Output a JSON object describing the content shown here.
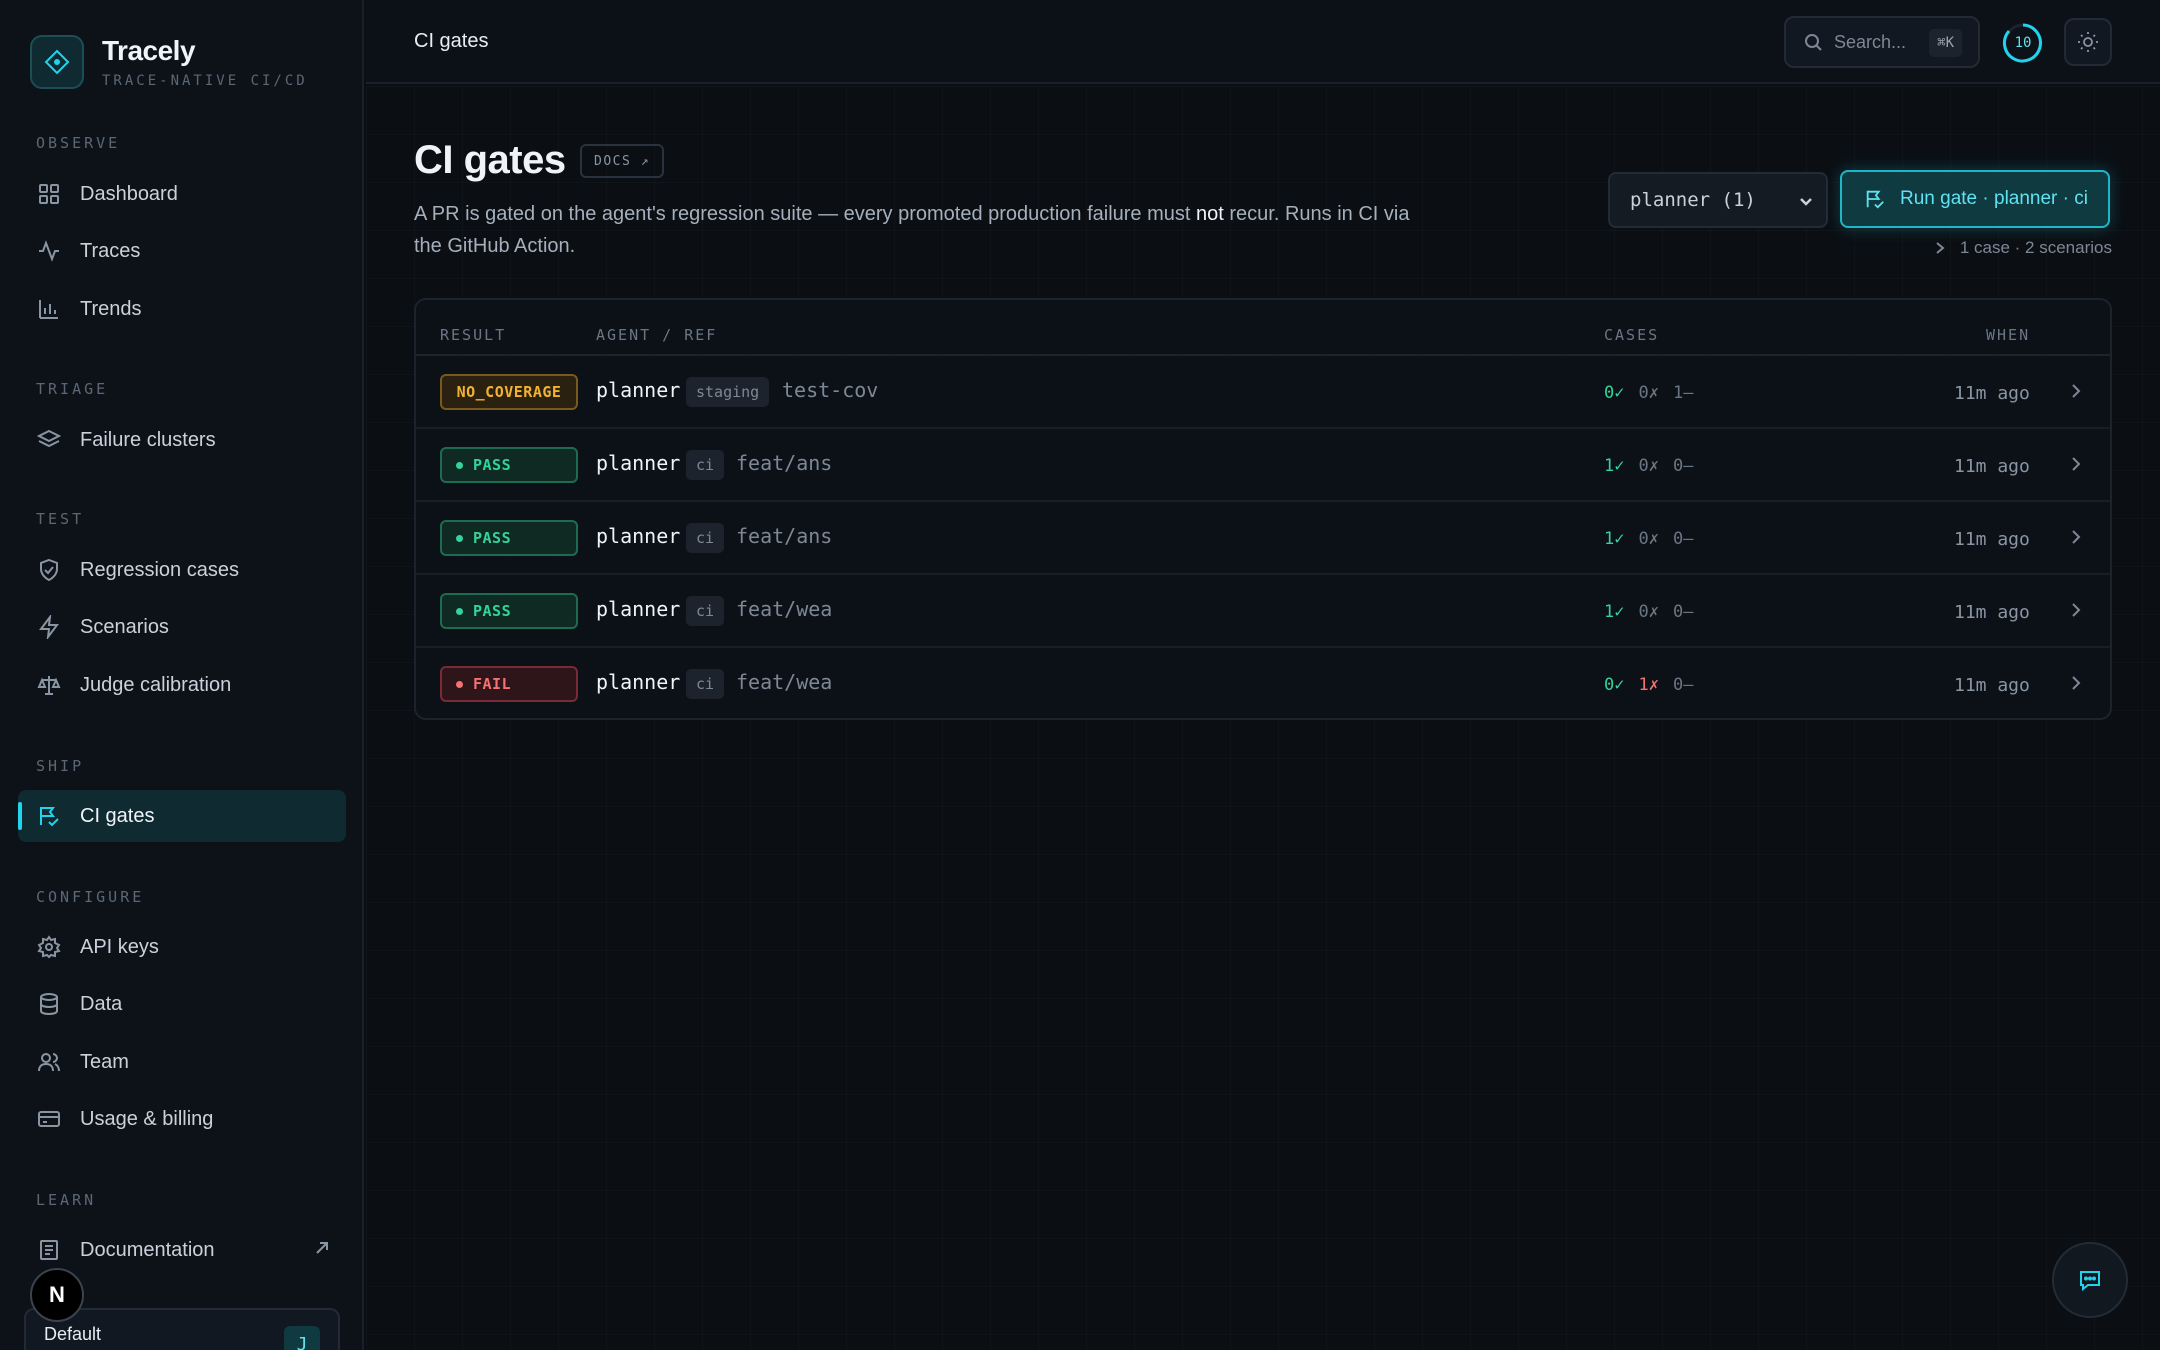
{
  "brand": {
    "name": "Tracely",
    "tagline": "TRACE-NATIVE CI/CD"
  },
  "sidebar": {
    "sections": [
      {
        "label": "OBSERVE",
        "items": [
          {
            "label": "Dashboard",
            "icon": "grid-icon"
          },
          {
            "label": "Traces",
            "icon": "activity-icon"
          },
          {
            "label": "Trends",
            "icon": "bar-chart-icon"
          }
        ]
      },
      {
        "label": "TRIAGE",
        "items": [
          {
            "label": "Failure clusters",
            "icon": "layers-icon"
          }
        ]
      },
      {
        "label": "TEST",
        "items": [
          {
            "label": "Regression cases",
            "icon": "shield-check-icon"
          },
          {
            "label": "Scenarios",
            "icon": "zap-icon"
          },
          {
            "label": "Judge calibration",
            "icon": "scale-icon"
          }
        ]
      },
      {
        "label": "SHIP",
        "items": [
          {
            "label": "CI gates",
            "icon": "flag-check-icon",
            "active": true
          }
        ]
      },
      {
        "label": "CONFIGURE",
        "items": [
          {
            "label": "API keys",
            "icon": "gear-icon"
          },
          {
            "label": "Data",
            "icon": "database-icon"
          },
          {
            "label": "Team",
            "icon": "users-icon"
          },
          {
            "label": "Usage & billing",
            "icon": "credit-card-icon"
          }
        ]
      },
      {
        "label": "LEARN",
        "items": [
          {
            "label": "Documentation",
            "icon": "book-icon",
            "external": true
          }
        ]
      }
    ],
    "workspace": {
      "name": "Default",
      "avatar": "J"
    },
    "n_badge": "N"
  },
  "topbar": {
    "breadcrumb": "CI gates",
    "search": {
      "placeholder": "Search...",
      "shortcut": "⌘K"
    },
    "counter": "10"
  },
  "page": {
    "title": "CI gates",
    "docs_label": "DOCS ↗",
    "description_before": "A PR is gated on the agent's regression suite — every promoted production failure must ",
    "description_emph": "not",
    "description_after": " recur. Runs in CI via the GitHub Action.",
    "agent_select": "planner (1)",
    "run_button": "Run gate · planner · ci",
    "case_summary": "1 case · 2 scenarios"
  },
  "table": {
    "columns": {
      "result": "RESULT",
      "agent_ref": "AGENT / REF",
      "cases": "CASES",
      "when": "WHEN"
    },
    "rows": [
      {
        "result": "NO_COVERAGE",
        "agent": "planner",
        "env": "staging",
        "ref": "test-cov",
        "pass": "0✓",
        "fail": "0✗",
        "none": "1–",
        "when": "11m ago"
      },
      {
        "result": "PASS",
        "agent": "planner",
        "env": "ci",
        "ref": "feat/ans",
        "pass": "1✓",
        "fail": "0✗",
        "none": "0–",
        "when": "11m ago"
      },
      {
        "result": "PASS",
        "agent": "planner",
        "env": "ci",
        "ref": "feat/ans",
        "pass": "1✓",
        "fail": "0✗",
        "none": "0–",
        "when": "11m ago"
      },
      {
        "result": "PASS",
        "agent": "planner",
        "env": "ci",
        "ref": "feat/wea",
        "pass": "1✓",
        "fail": "0✗",
        "none": "0–",
        "when": "11m ago"
      },
      {
        "result": "FAIL",
        "agent": "planner",
        "env": "ci",
        "ref": "feat/wea",
        "pass": "0✓",
        "fail": "1✗",
        "none": "0–",
        "when": "11m ago"
      }
    ]
  },
  "colors": {
    "accent": "#22d3ee",
    "pass": "#34d399",
    "fail": "#f87171",
    "warn": "#f2b233"
  }
}
